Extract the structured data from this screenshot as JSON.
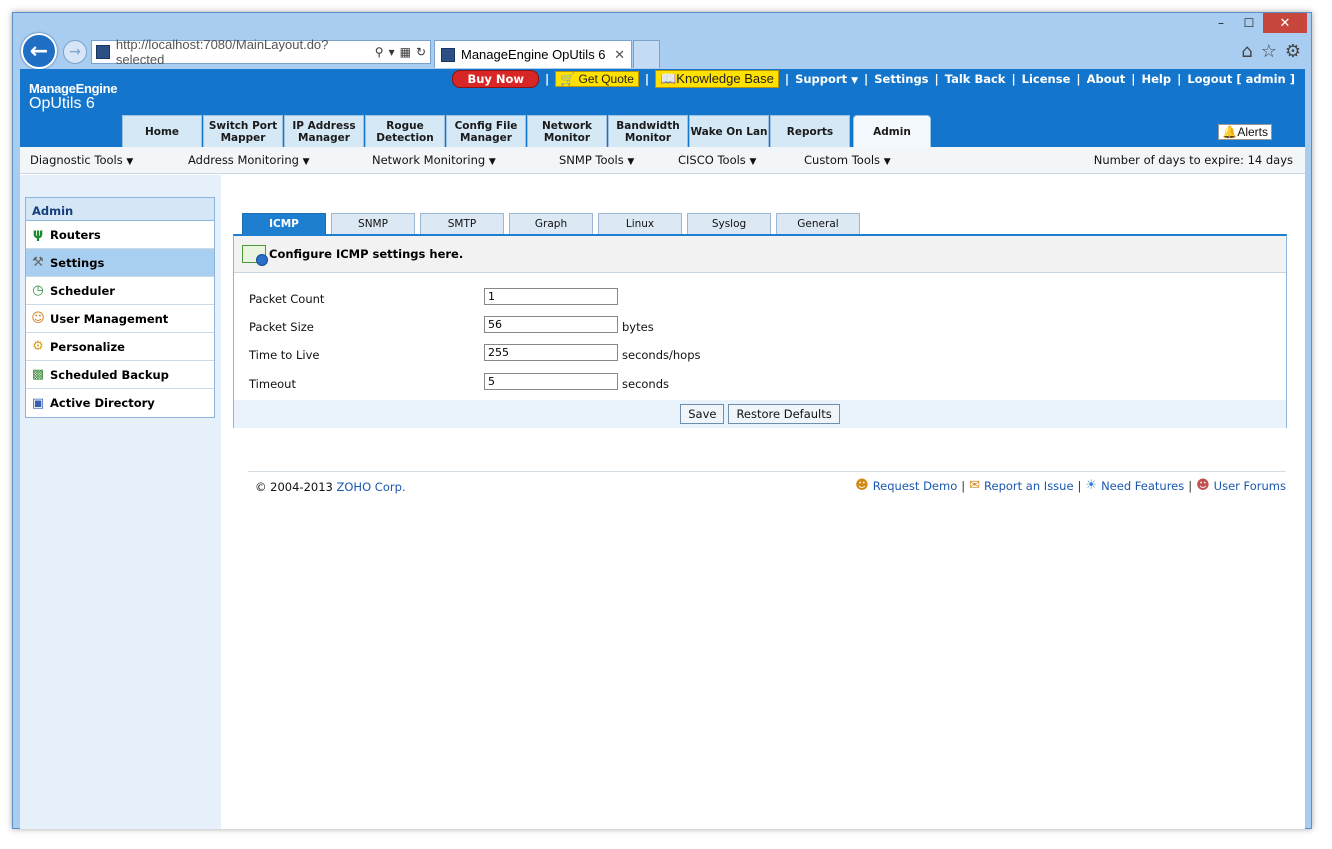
{
  "browser": {
    "address": "http://localhost:7080/MainLayout.do?selected",
    "tab_title": "ManageEngine OpUtils 6",
    "window_controls": {
      "minimize": "–",
      "maximize": "☐",
      "close": "✕"
    }
  },
  "app": {
    "logo_line1": "ManageEngine",
    "logo_line2": "OpUtils 6"
  },
  "topnav": {
    "buy_now": "Buy Now",
    "get_quote": "Get Quote",
    "knowledge_base": "Knowledge Base",
    "support": "Support",
    "settings": "Settings",
    "talk_back": "Talk Back",
    "license": "License",
    "about": "About",
    "help": "Help",
    "logout": "Logout [ admin ]",
    "separator": "|"
  },
  "main_tabs": [
    {
      "label": "Home"
    },
    {
      "label": "Switch Port Mapper"
    },
    {
      "label": "IP Address Manager"
    },
    {
      "label": "Rogue Detection"
    },
    {
      "label": "Config File Manager"
    },
    {
      "label": "Network Monitor"
    },
    {
      "label": "Bandwidth Monitor"
    },
    {
      "label": "Wake On Lan"
    },
    {
      "label": "Reports"
    },
    {
      "label": "Admin"
    }
  ],
  "alerts_label": "Alerts",
  "subnav": {
    "diagnostic": "Diagnostic Tools",
    "address": "Address Monitoring",
    "network": "Network Monitoring",
    "snmp": "SNMP Tools",
    "cisco": "CISCO Tools",
    "custom": "Custom Tools",
    "expiry": "Number of days to expire: 14 days"
  },
  "sidebar": {
    "title": "Admin",
    "items": [
      {
        "label": "Routers"
      },
      {
        "label": "Settings"
      },
      {
        "label": "Scheduler"
      },
      {
        "label": "User Management"
      },
      {
        "label": "Personalize"
      },
      {
        "label": "Scheduled Backup"
      },
      {
        "label": "Active Directory"
      }
    ]
  },
  "content_tabs": [
    "ICMP",
    "SNMP",
    "SMTP",
    "Graph",
    "Linux",
    "Syslog",
    "General"
  ],
  "form": {
    "heading": "Configure ICMP settings here.",
    "fields": [
      {
        "label": "Packet Count",
        "value": "1",
        "unit": ""
      },
      {
        "label": "Packet Size",
        "value": "56",
        "unit": "bytes"
      },
      {
        "label": "Time to Live",
        "value": "255",
        "unit": "seconds/hops"
      },
      {
        "label": "Timeout",
        "value": "5",
        "unit": "seconds"
      }
    ],
    "save": "Save",
    "restore": "Restore Defaults"
  },
  "footer": {
    "copyright": "© 2004-2013",
    "company": "ZOHO Corp.",
    "request_demo": "Request Demo",
    "report_issue": "Report an Issue",
    "need_features": "Need Features",
    "user_forums": "User Forums",
    "separator": "|"
  }
}
